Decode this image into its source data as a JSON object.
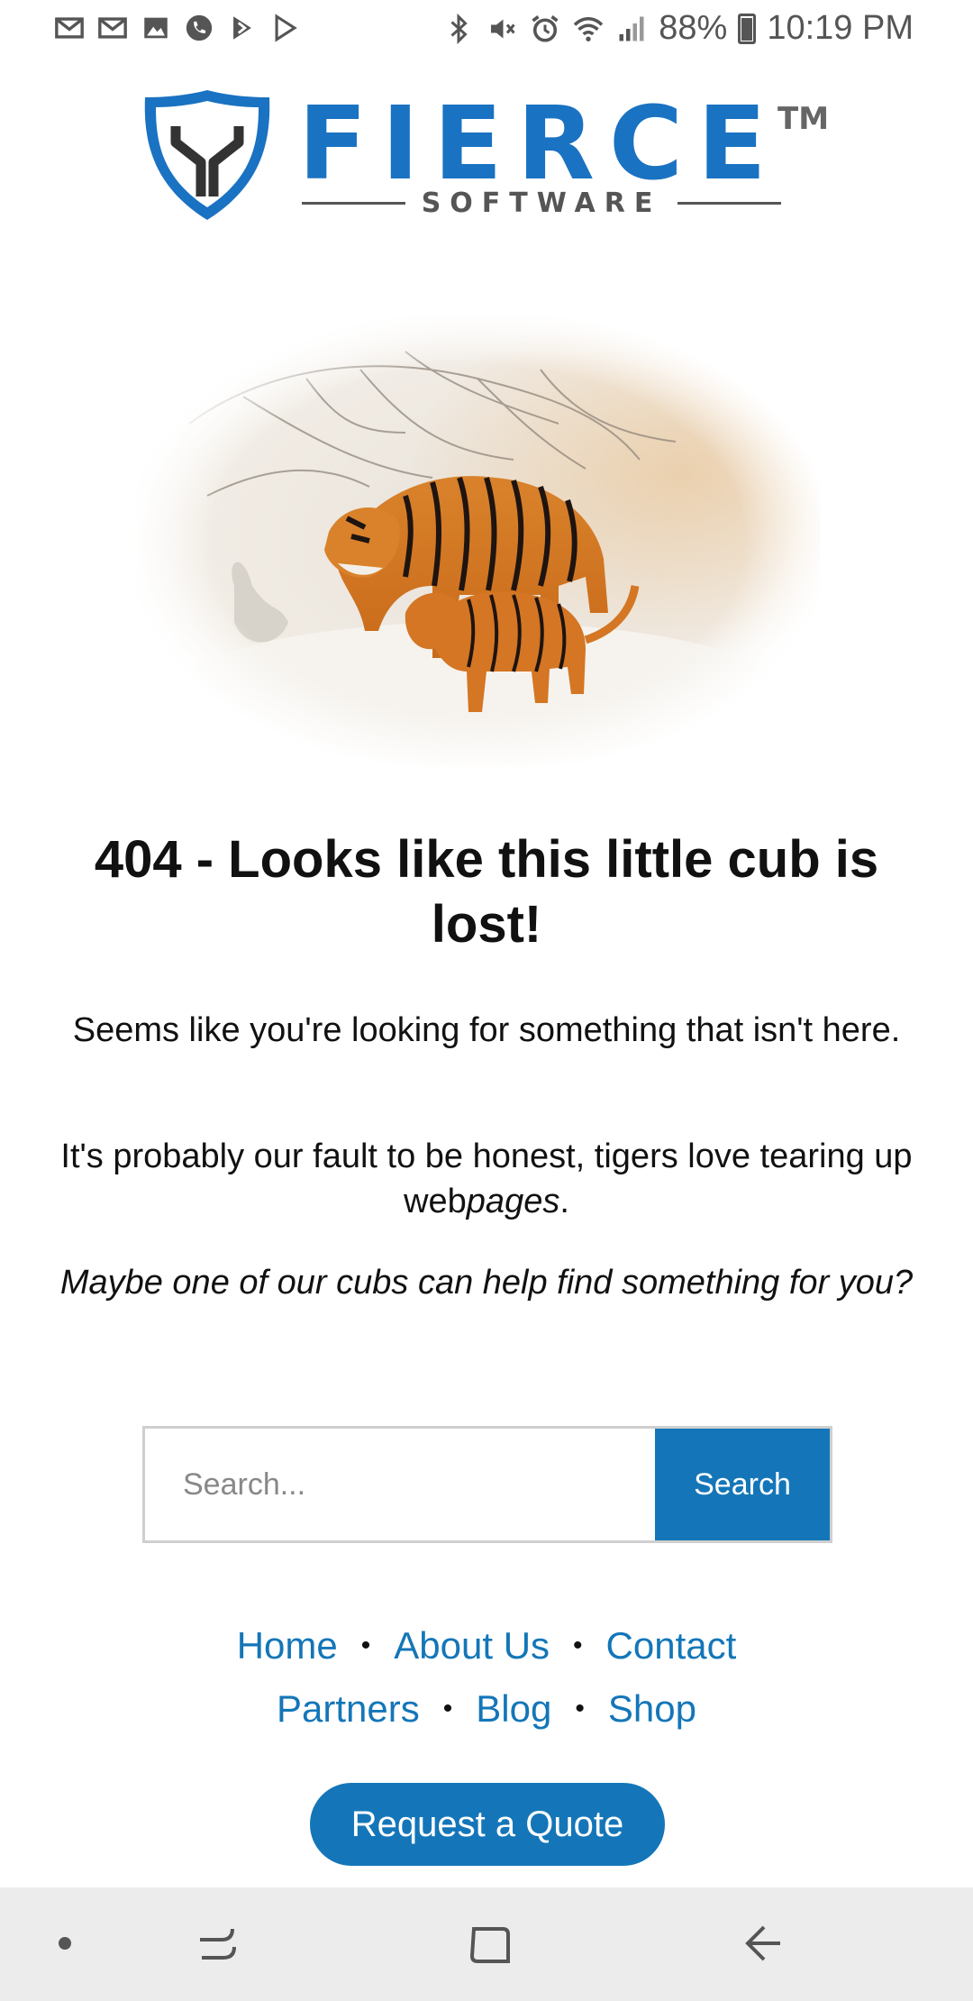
{
  "status_bar": {
    "left_icons": [
      "gmail-icon",
      "gmail-icon",
      "gallery-icon",
      "phone-icon",
      "play-store-icon",
      "play-store-icon"
    ],
    "right_icons": [
      "bluetooth-icon",
      "mute-icon",
      "alarm-icon",
      "wifi-icon",
      "signal-icon",
      "battery-icon"
    ],
    "battery": "88%",
    "time": "10:19 PM"
  },
  "logo": {
    "word": "FIERCE",
    "tm": "TM",
    "subtitle": "SOFTWARE",
    "color": "#1a72c2"
  },
  "hero": {
    "icon": "tigers-in-snow-image"
  },
  "headline": "404 - Looks like this little cub is lost!",
  "paragraph1": "Seems like you're looking for something that isn't here.",
  "paragraph2_prefix": "It's probably our fault to be honest, tigers love tearing up web",
  "paragraph2_emph": "pages",
  "paragraph2_suffix": ".",
  "paragraph3": "Maybe one of our cubs can help find something for you?",
  "search": {
    "placeholder": "Search...",
    "value": "",
    "button_label": "Search"
  },
  "footer_nav": {
    "row1": [
      "Home",
      "About Us",
      "Contact"
    ],
    "row2": [
      "Partners",
      "Blog",
      "Shop"
    ]
  },
  "cta_label": "Request a Quote",
  "colors": {
    "accent": "#1476b8",
    "nav_bar": "#ececec"
  },
  "system_nav": [
    "dot-icon",
    "recents-icon",
    "home-icon",
    "back-icon"
  ]
}
